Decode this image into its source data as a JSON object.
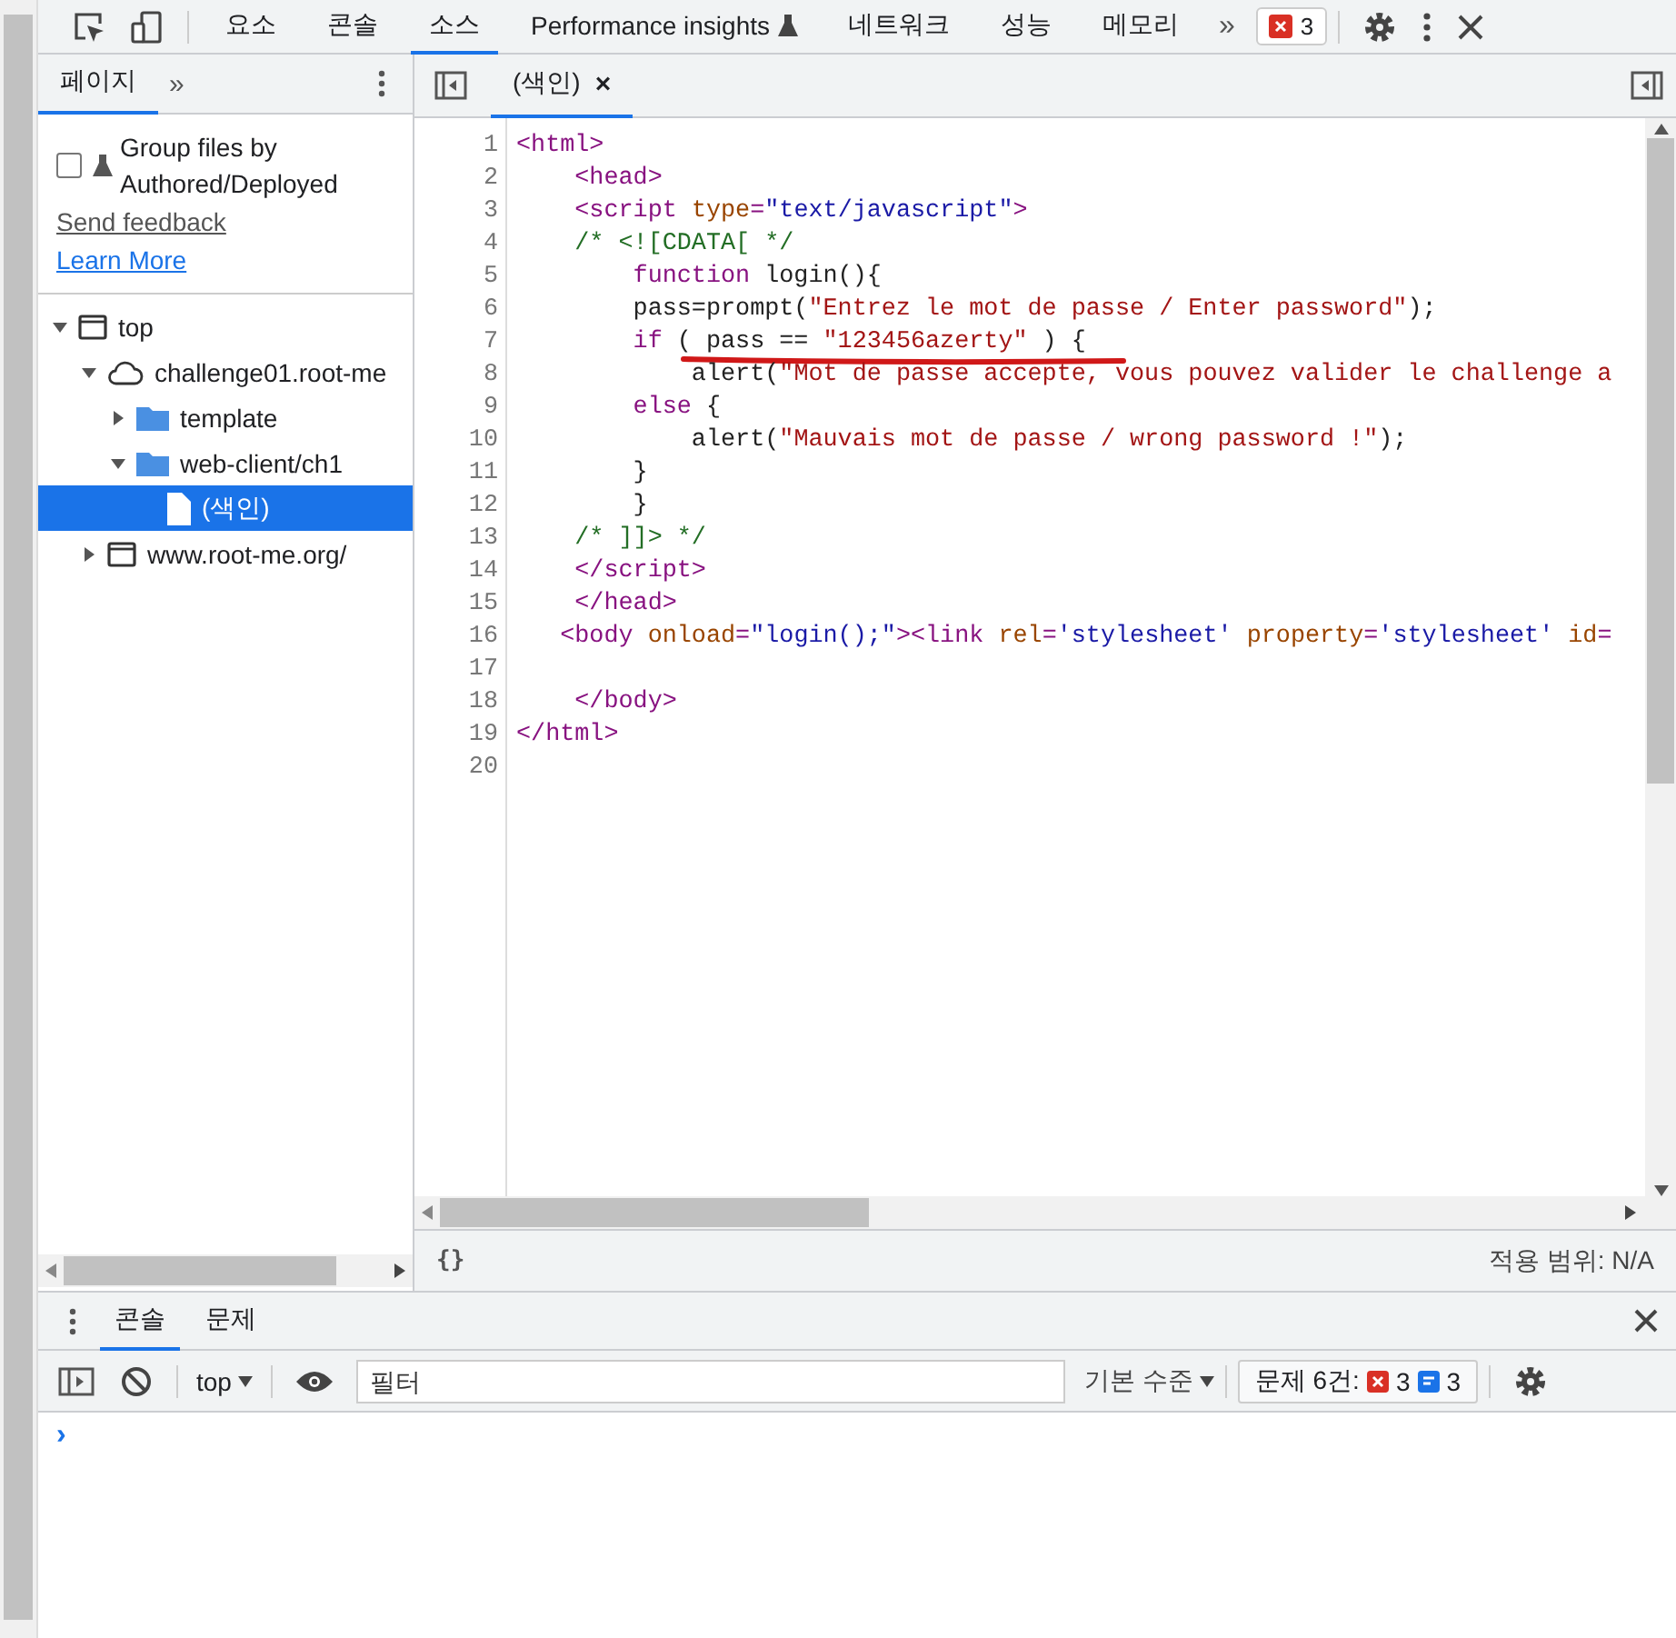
{
  "toolbar": {
    "tabs": [
      {
        "label": "요소",
        "selected": false
      },
      {
        "label": "콘솔",
        "selected": false
      },
      {
        "label": "소스",
        "selected": true
      },
      {
        "label": "Performance insights",
        "selected": false,
        "experimental": true
      },
      {
        "label": "네트워크",
        "selected": false
      },
      {
        "label": "성능",
        "selected": false
      },
      {
        "label": "메모리",
        "selected": false
      }
    ],
    "overflow": "»",
    "error_count": "3"
  },
  "navigator": {
    "tabs": [
      {
        "label": "페이지",
        "selected": true
      }
    ],
    "overflow": "»",
    "group_files": {
      "label": "Group files by Authored/Deployed",
      "checked": false
    },
    "links": [
      {
        "label": "Send feedback",
        "kind": "feedback"
      },
      {
        "label": "Learn More",
        "kind": "learn"
      }
    ],
    "tree": [
      {
        "label": "top",
        "kind": "frame",
        "expanded": true,
        "selected": false,
        "children": [
          {
            "label": "challenge01.root-me",
            "kind": "domain",
            "expanded": true,
            "selected": false,
            "children": [
              {
                "label": "template",
                "kind": "folder",
                "expanded": false,
                "selected": false
              },
              {
                "label": "web-client/ch1",
                "kind": "folder",
                "expanded": true,
                "selected": false,
                "children": [
                  {
                    "label": "(색인)",
                    "kind": "file",
                    "selected": true
                  }
                ]
              }
            ]
          },
          {
            "label": "www.root-me.org/",
            "kind": "frame",
            "expanded": false,
            "selected": false
          }
        ]
      }
    ]
  },
  "editor": {
    "tabs": [
      {
        "label": "(색인)",
        "selected": true,
        "close": "×"
      }
    ],
    "lines": [
      {
        "number": "1",
        "tokens": [
          {
            "kind": "tag",
            "text": "<html>"
          }
        ]
      },
      {
        "number": "2",
        "tokens": [
          {
            "kind": "tag",
            "text": "    <head>"
          }
        ]
      },
      {
        "number": "3",
        "tokens": [
          {
            "kind": "tag",
            "text": "    <script "
          },
          {
            "kind": "attr",
            "text": "type"
          },
          {
            "kind": "tag",
            "text": "="
          },
          {
            "kind": "value",
            "text": "\"text/javascript\""
          },
          {
            "kind": "tag",
            "text": ">"
          }
        ]
      },
      {
        "number": "4",
        "tokens": [
          {
            "kind": "comment",
            "text": "    /* <![CDATA[ */"
          }
        ]
      },
      {
        "number": "5",
        "tokens": [
          {
            "kind": "keyword",
            "text": "        function"
          },
          {
            "kind": "plain",
            "text": " login(){"
          }
        ]
      },
      {
        "number": "6",
        "tokens": [
          {
            "kind": "plain",
            "text": "        pass=prompt("
          },
          {
            "kind": "string",
            "text": "\"Entrez le mot de passe / Enter password\""
          },
          {
            "kind": "plain",
            "text": ");"
          }
        ]
      },
      {
        "number": "7",
        "tokens": [
          {
            "kind": "keyword",
            "text": "        if"
          },
          {
            "kind": "plain",
            "text": " ( pass == "
          },
          {
            "kind": "string",
            "text": "\"123456azerty\""
          },
          {
            "kind": "plain",
            "text": " ) {"
          }
        ],
        "underlined": true
      },
      {
        "number": "8",
        "tokens": [
          {
            "kind": "plain",
            "text": "            alert("
          },
          {
            "kind": "string",
            "text": "\"Mot de passe accepte, vous pouvez valider le challenge a"
          }
        ]
      },
      {
        "number": "9",
        "tokens": [
          {
            "kind": "keyword",
            "text": "        else"
          },
          {
            "kind": "plain",
            "text": " {"
          }
        ]
      },
      {
        "number": "10",
        "tokens": [
          {
            "kind": "plain",
            "text": "            alert("
          },
          {
            "kind": "string",
            "text": "\"Mauvais mot de passe / wrong password !\""
          },
          {
            "kind": "plain",
            "text": ");"
          }
        ]
      },
      {
        "number": "11",
        "tokens": [
          {
            "kind": "plain",
            "text": "        }"
          }
        ]
      },
      {
        "number": "12",
        "tokens": [
          {
            "kind": "plain",
            "text": "        }"
          }
        ]
      },
      {
        "number": "13",
        "tokens": [
          {
            "kind": "comment",
            "text": "    /* ]]> */"
          }
        ]
      },
      {
        "number": "14",
        "tokens": [
          {
            "kind": "tag",
            "text": "    </script>"
          }
        ]
      },
      {
        "number": "15",
        "tokens": [
          {
            "kind": "tag",
            "text": "    </head>"
          }
        ]
      },
      {
        "number": "16",
        "tokens": [
          {
            "kind": "tag",
            "text": "   <body "
          },
          {
            "kind": "attr",
            "text": "onload"
          },
          {
            "kind": "tag",
            "text": "="
          },
          {
            "kind": "value",
            "text": "\"login();\""
          },
          {
            "kind": "tag",
            "text": "><link "
          },
          {
            "kind": "attr",
            "text": "rel"
          },
          {
            "kind": "tag",
            "text": "="
          },
          {
            "kind": "value",
            "text": "'stylesheet'"
          },
          {
            "kind": "attr",
            "text": " property"
          },
          {
            "kind": "tag",
            "text": "="
          },
          {
            "kind": "value",
            "text": "'stylesheet'"
          },
          {
            "kind": "attr",
            "text": " id"
          },
          {
            "kind": "tag",
            "text": "="
          }
        ]
      },
      {
        "number": "17"
      },
      {
        "number": "18",
        "tokens": [
          {
            "kind": "tag",
            "text": "    </body>"
          }
        ]
      },
      {
        "number": "19",
        "tokens": [
          {
            "kind": "tag",
            "text": "</html>"
          }
        ]
      },
      {
        "number": "20"
      }
    ],
    "status": {
      "format": "{}",
      "coverage": "적용 범위: N/A"
    }
  },
  "drawer": {
    "tabs": [
      {
        "label": "콘솔",
        "selected": true
      },
      {
        "label": "문제",
        "selected": false
      }
    ],
    "context": "top",
    "filter_placeholder": "필터",
    "levels": "기본 수준",
    "issues": {
      "label": "문제 6건:",
      "errors": "3",
      "messages": "3"
    },
    "prompt": "›"
  }
}
